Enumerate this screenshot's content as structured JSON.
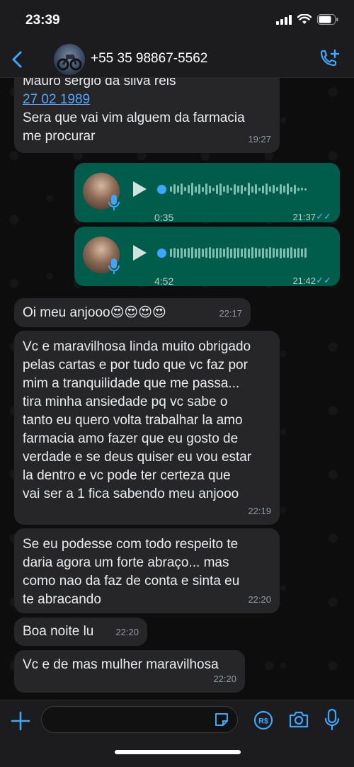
{
  "status_bar": {
    "time": "23:39"
  },
  "header": {
    "contact": "+55 35 98867-5562"
  },
  "messages": {
    "m1": {
      "line1": "Mauro sergio da silva reis",
      "link": "27 02 1989",
      "text": "Sera que vai vim alguem da farmacia\nme procurar",
      "time": "19:27"
    },
    "v1": {
      "duration": "0:35",
      "time": "21:37"
    },
    "v2": {
      "duration": "4:52",
      "time": "21:42"
    },
    "m2": {
      "text": "Oi meu anjooo😍😍😍😍",
      "time": "22:17"
    },
    "m3": {
      "text": "Vc e maravilhosa linda muito obrigado\npelas cartas e por tudo que vc faz por\nmim a tranquilidade  que me passa...\ntira minha ansiedade pq vc sabe o\ntanto eu quero volta trabalhar la amo\nfarmacia amo fazer que eu gosto de\nverdade e se deus quiser eu vou estar\nla dentro e vc pode ter certeza que\nvai ser a 1 fica sabendo meu anjooo",
      "time": "22:19"
    },
    "m4": {
      "text": "Se eu podesse com todo respeito te\ndaria agora um forte abraço... mas\ncomo nao da  faz de conta e sinta eu\nte abracando",
      "time": "22:20"
    },
    "m5": {
      "text": "Boa noite lu",
      "time": "22:20"
    },
    "m6": {
      "text": "Vc e de mas mulher maravilhosa",
      "time": "22:20"
    }
  },
  "composer": {
    "pay_label": "R$"
  },
  "icons": [
    "back-icon",
    "phone-add-icon",
    "play-icon",
    "mic-icon",
    "plus-icon",
    "sticker-icon",
    "camera-icon"
  ],
  "colors": {
    "outgoing_bubble": "#005c4b",
    "incoming_bubble": "#262628",
    "accent": "#3ea6ff"
  }
}
